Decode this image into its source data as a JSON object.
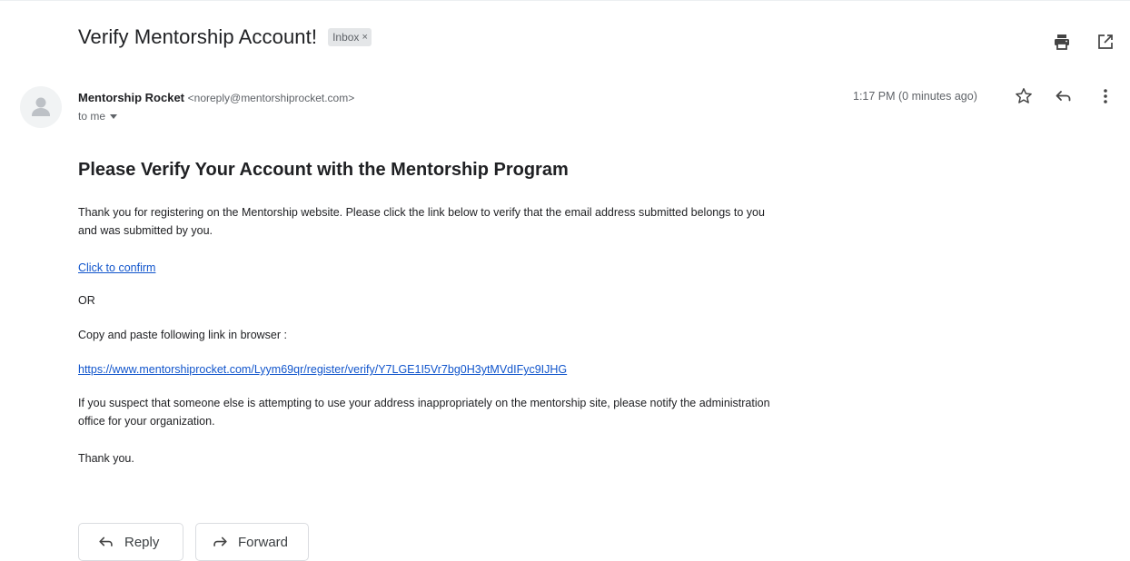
{
  "email": {
    "subject": "Verify Mentorship Account!",
    "label": "Inbox",
    "label_close": "×",
    "sender_name": "Mentorship Rocket",
    "sender_email": "<noreply@mentorshiprocket.com>",
    "to": "to me",
    "timestamp": "1:17 PM (0 minutes ago)"
  },
  "body": {
    "heading": "Please Verify Your Account with the Mentorship Program",
    "p1_line1": "Thank you for registering on the Mentorship website. Please click the link below to verify that the email address submitted belongs to you",
    "p1_line2": "and was submitted by you.",
    "confirm_link": "Click to confirm",
    "or": "OR",
    "copy_text": "Copy and paste following link in browser :",
    "verify_url": "https://www.mentorshiprocket.com/Lyym69qr/register/verify/Y7LGE1I5Vr7bg0H3ytMVdIFyc9IJHG",
    "p2_line1": "If you suspect that someone else is attempting to use your address inappropriately on the mentorship site, please notify the administration",
    "p2_line2": "office for your organization.",
    "thanks": "Thank you."
  },
  "actions": {
    "reply": "Reply",
    "forward": "Forward"
  },
  "icons": [
    "print-icon",
    "open-in-new-window-icon",
    "star-icon",
    "reply-icon",
    "more-options-icon",
    "avatar-icon"
  ]
}
